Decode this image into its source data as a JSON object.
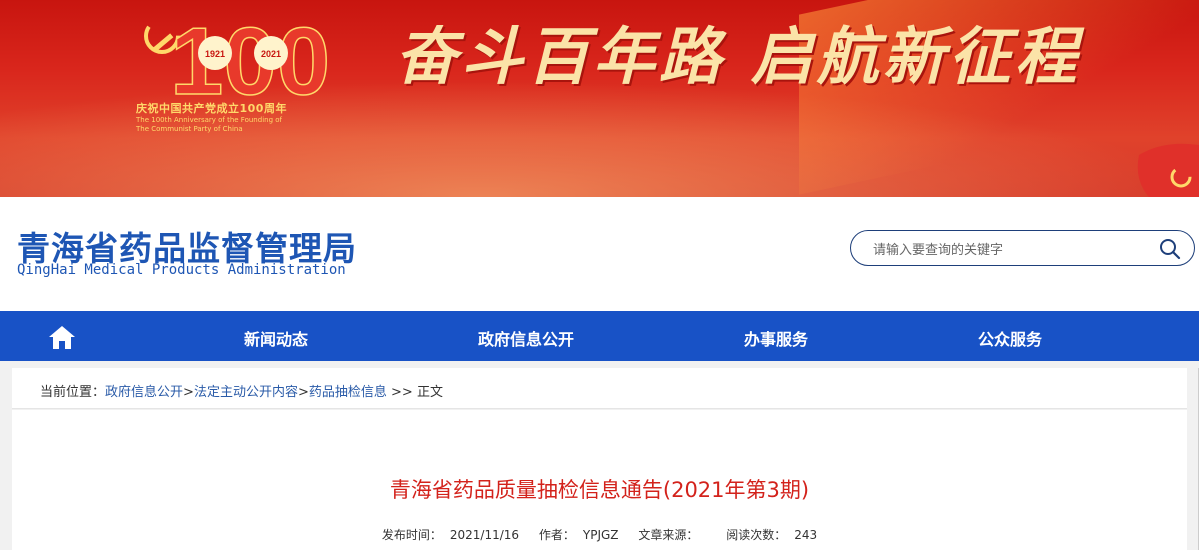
{
  "banner": {
    "logo_number": "100",
    "logo_years": [
      "1921",
      "2021"
    ],
    "logo_caption_cn": "庆祝中国共产党成立100周年",
    "logo_caption_en_1": "The 100th Anniversary of the Founding of",
    "logo_caption_en_2": "The Communist Party of China",
    "slogan": "奋斗百年路 启航新征程"
  },
  "header": {
    "title": "青海省药品监督管理局",
    "subtitle": "QingHai Medical Products Administration"
  },
  "search": {
    "placeholder": "请输入要查询的关键字"
  },
  "nav": {
    "items": [
      "新闻动态",
      "政府信息公开",
      "办事服务",
      "公众服务"
    ]
  },
  "breadcrumb": {
    "prefix": "当前位置：",
    "links": [
      "政府信息公开",
      "法定主动公开内容",
      "药品抽检信息"
    ],
    "separator": ">",
    "tail_separator": " >> ",
    "current": "正文"
  },
  "article": {
    "title": "青海省药品质量抽检信息通告(2021年第3期)",
    "meta": {
      "publish_label": "发布时间：",
      "publish_date": "2021/11/16",
      "author_label": "作者：",
      "author": "YPJGZ",
      "source_label": "文章来源：",
      "source": "",
      "views_label": "阅读次数：",
      "views": "243"
    }
  },
  "colors": {
    "banner_red": "#d9261c",
    "title_blue": "#1e56b4",
    "nav_blue": "#1852c6",
    "article_title_red": "#d3221b",
    "link_blue": "#2a5ba8"
  }
}
